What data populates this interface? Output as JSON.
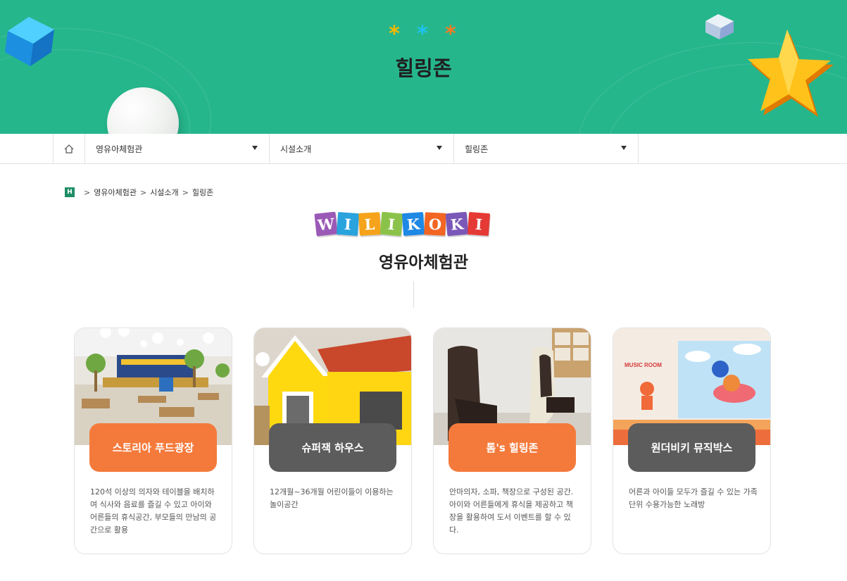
{
  "banner": {
    "title": "힐링존",
    "stars": [
      "*",
      "*",
      "*"
    ],
    "star_colors": [
      "#f5b800",
      "#1ec2f0",
      "#f57c22"
    ],
    "background_color": "#26b68c"
  },
  "nav": {
    "home_icon": "home-icon",
    "dropdowns": [
      {
        "label": "영유아체험관"
      },
      {
        "label": "시설소개"
      },
      {
        "label": "힐링존"
      }
    ]
  },
  "breadcrumb": {
    "home_badge": "H",
    "items": [
      "영유아체험관",
      "시설소개",
      "힐링존"
    ],
    "separator": ">"
  },
  "logo": {
    "letters": [
      "W",
      "I",
      "L",
      "I",
      "K",
      "O",
      "K",
      "I"
    ],
    "colors": [
      "#9b59b6",
      "#29a3dd",
      "#f5a31a",
      "#8bc34a",
      "#1e88e5",
      "#f26522",
      "#7b58b8",
      "#e53935"
    ]
  },
  "section": {
    "title": "영유아체험관"
  },
  "cards": [
    {
      "title": "스토리아 푸드광장",
      "desc": "120석 이상의 의자와 테이블을 배치하여 식사와 음료를 즐길 수 있고 아이와 어른들의 휴식공간, 부모들의 만남의 공간으로 활용",
      "pill_color": "#f47a3c"
    },
    {
      "title": "슈퍼잭 하우스",
      "desc": "12개월~36개월 어린이들이 이용하는 놀이공간",
      "pill_color": "#5c5c5c"
    },
    {
      "title": "톰's 힐링존",
      "desc": "안마의자, 소파, 책장으로 구성된 공간. 아이와 어른들에게 휴식을 제공하고 책장을 활용하여 도서 이벤트를 할 수 있다.",
      "pill_color": "#f47a3c"
    },
    {
      "title": "원더비키 뮤직박스",
      "desc": "어른과 아이들 모두가 즐길 수 있는 가족단위 수용가능한 노래방",
      "pill_color": "#5c5c5c",
      "photo_sign": "MUSIC ROOM"
    }
  ]
}
